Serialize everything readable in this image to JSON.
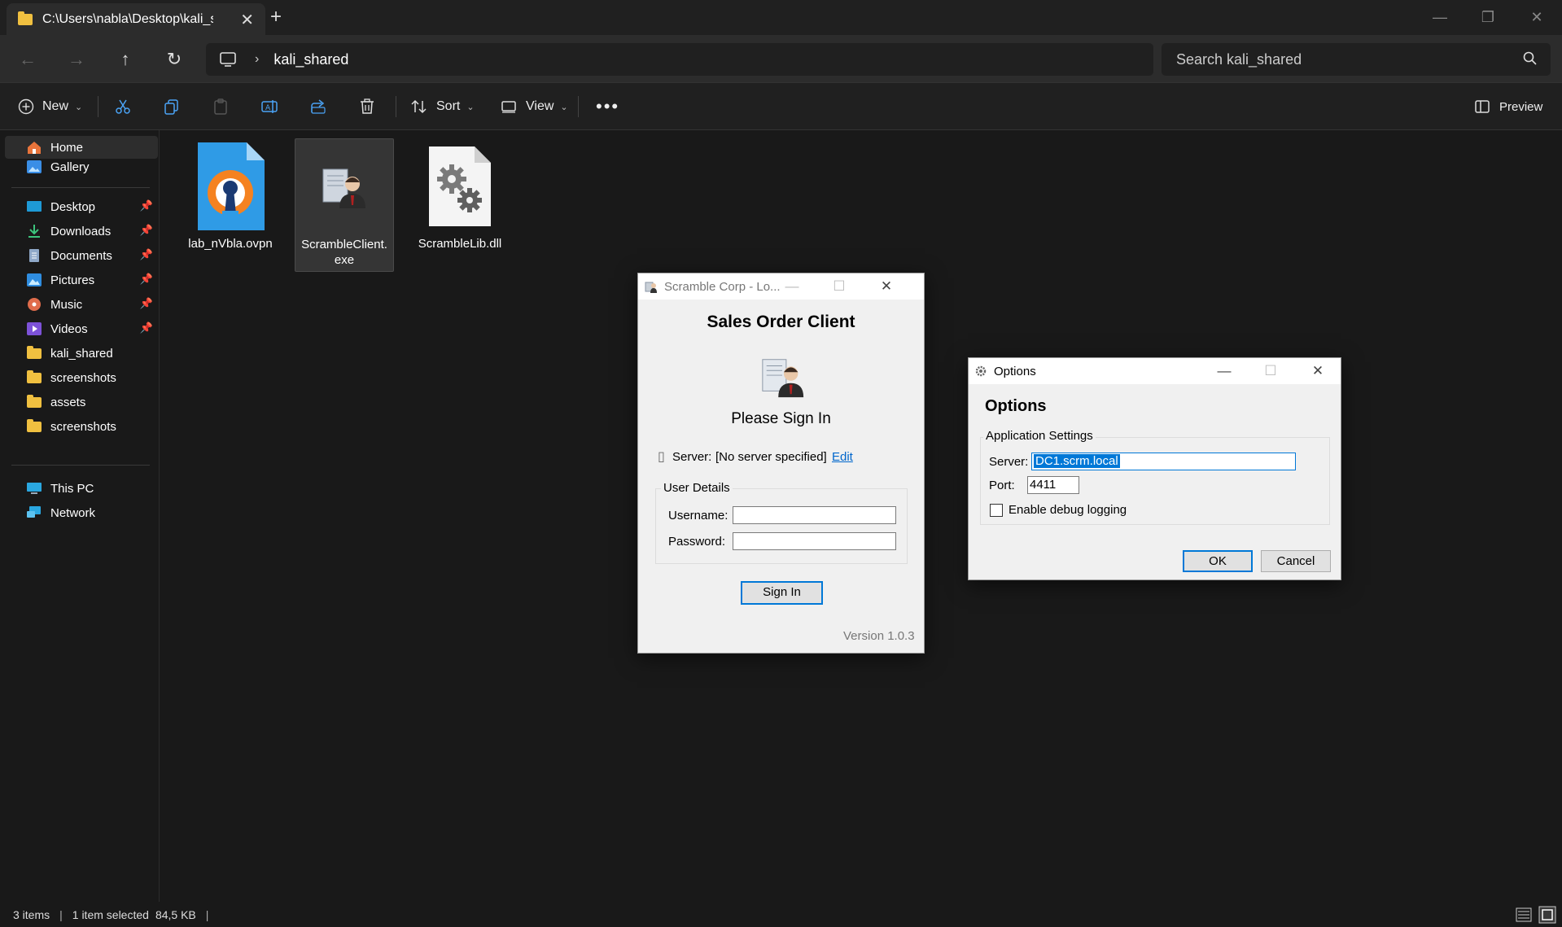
{
  "explorer": {
    "tab_title": "C:\\Users\\nabla\\Desktop\\kali_s",
    "breadcrumb": "kali_shared",
    "search_placeholder": "Search kali_shared",
    "toolbar": {
      "new_label": "New",
      "sort_label": "Sort",
      "view_label": "View",
      "preview_label": "Preview"
    },
    "sidebar": {
      "quick": [
        "Home",
        "Gallery"
      ],
      "pinned": [
        "Desktop",
        "Downloads",
        "Documents",
        "Pictures",
        "Music",
        "Videos"
      ],
      "folders": [
        "kali_shared",
        "screenshots",
        "assets",
        "screenshots"
      ],
      "system": [
        "This PC",
        "Network"
      ]
    },
    "files": [
      {
        "name": "lab_nVbla.ovpn",
        "icon": "openvpn-icon"
      },
      {
        "name": "ScrambleClient.exe",
        "icon": "scramble-client-icon"
      },
      {
        "name": "ScrambleLib.dll",
        "icon": "dll-gear-icon"
      }
    ],
    "status": {
      "items": "3 items",
      "selected": "1 item selected",
      "size": "84,5 KB"
    }
  },
  "login_dialog": {
    "title": "Scramble Corp - Lo...",
    "heading": "Sales Order Client",
    "subheading": "Please Sign In",
    "server_label": "Server:",
    "server_value": "[No server specified]",
    "edit_link": "Edit",
    "group_label": "User Details",
    "username_label": "Username:",
    "password_label": "Password:",
    "sign_in_label": "Sign In",
    "version": "Version 1.0.3"
  },
  "options_dialog": {
    "title": "Options",
    "heading": "Options",
    "group_label": "Application Settings",
    "server_label": "Server:",
    "server_value": "DC1.scrm.local",
    "port_label": "Port:",
    "port_value": "4411",
    "debug_label": "Enable debug logging",
    "debug_checked": false,
    "ok_label": "OK",
    "cancel_label": "Cancel"
  }
}
